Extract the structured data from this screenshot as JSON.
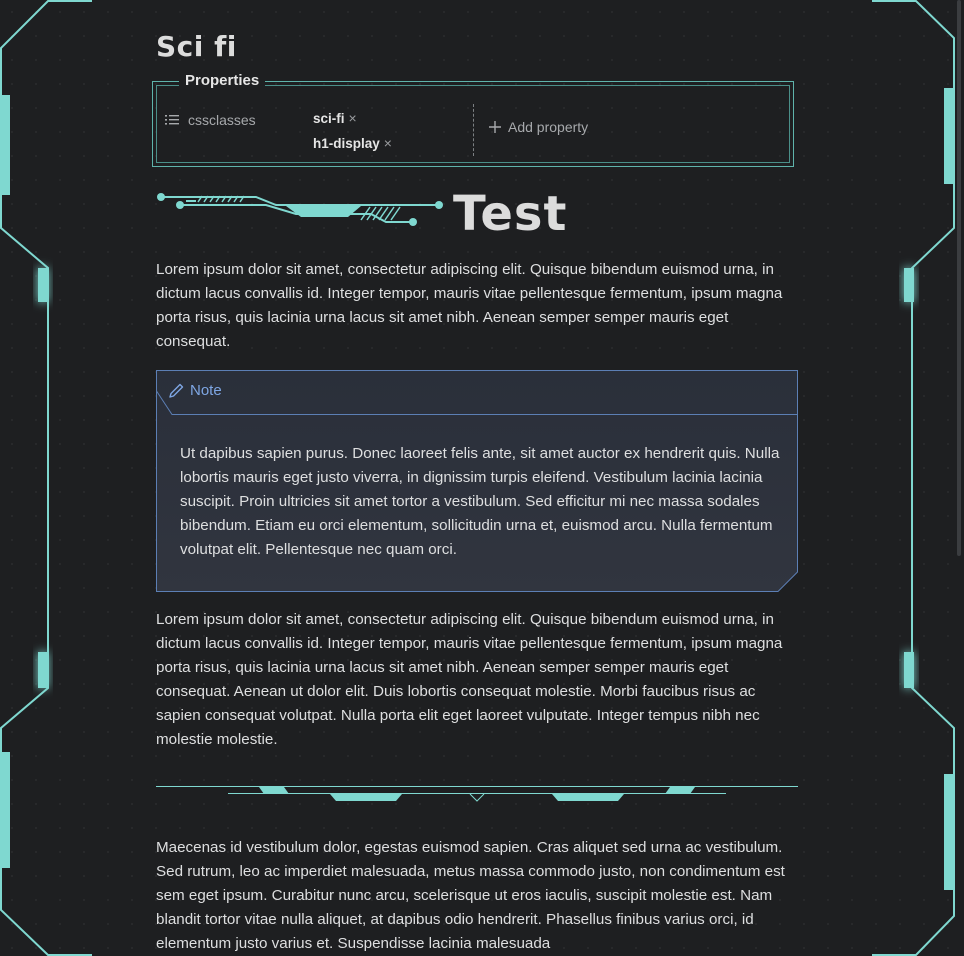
{
  "note": {
    "title": "Sci fi",
    "properties": {
      "heading": "Properties",
      "key_icon": "list-icon",
      "key": "cssclasses",
      "values": [
        {
          "label": "sci-fi",
          "remove": "×"
        },
        {
          "label": "h1-display",
          "remove": "×"
        }
      ],
      "add_icon": "plus-icon",
      "add_label": "Add property"
    },
    "heading": "Test",
    "paragraphs": [
      "Lorem ipsum dolor sit amet, consectetur adipiscing elit. Quisque bibendum euismod urna, in dictum lacus convallis id. Integer tempor, mauris vitae pellentesque fermentum, ipsum magna porta risus, quis lacinia urna lacus sit amet nibh. Aenean semper semper mauris eget consequat.",
      "Lorem ipsum dolor sit amet, consectetur adipiscing elit. Quisque bibendum euismod urna, in dictum lacus convallis id. Integer tempor, mauris vitae pellentesque fermentum, ipsum magna porta risus, quis lacinia urna lacus sit amet nibh. Aenean semper semper mauris eget consequat. Aenean ut dolor elit. Duis lobortis consequat molestie. Morbi faucibus risus ac sapien consequat volutpat. Nulla porta elit eget laoreet vulputate. Integer tempus nibh nec molestie molestie.",
      "Maecenas id vestibulum dolor, egestas euismod sapien. Cras aliquet sed urna ac vestibulum. Sed rutrum, leo ac imperdiet malesuada, metus massa commodo justo, non condimentum est sem eget ipsum. Curabitur nunc arcu, scelerisque ut eros iaculis, suscipit molestie est. Nam blandit tortor vitae nulla aliquet, at dapibus odio hendrerit. Phasellus finibus varius orci, id elementum justo varius et. Suspendisse lacinia malesuada"
    ],
    "callout": {
      "icon": "pencil-icon",
      "title": "Note",
      "body": "Ut dapibus sapien purus. Donec laoreet felis ante, sit amet auctor ex hendrerit quis. Nulla lobortis mauris eget justo viverra, in dignissim turpis eleifend. Vestibulum lacinia lacinia suscipit. Proin ultricies sit amet tortor a vestibulum. Sed efficitur mi nec massa sodales bibendum. Etiam eu orci elementum, sollicitudin urna et, euismod arcu. Nulla fermentum volutpat elit. Pellentesque nec quam orci."
    }
  },
  "theme": {
    "accent": "#7fd8d0",
    "callout_accent": "#7ea6e3",
    "background": "#1e1f21",
    "text": "#dedfe0"
  }
}
